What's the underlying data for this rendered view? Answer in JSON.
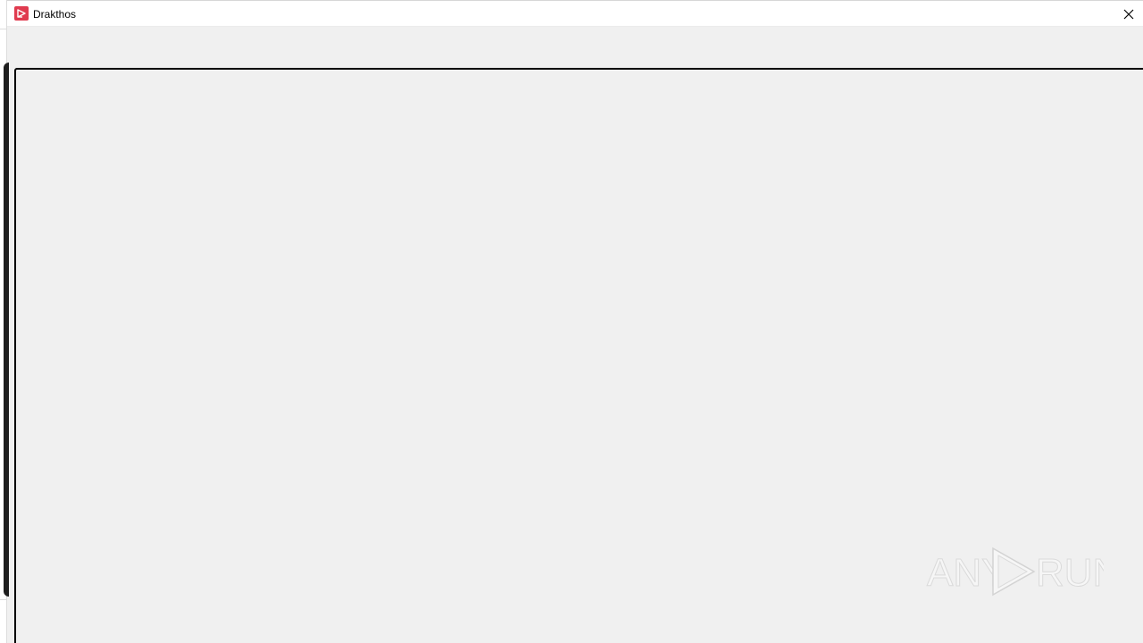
{
  "window": {
    "title": "Drakthos",
    "icon": "app-logo-icon",
    "close_icon": "close-icon"
  },
  "watermark": {
    "text_left": "ANY",
    "text_right": "RUN",
    "icon": "play-triangle-icon"
  },
  "colors": {
    "app_icon": "#e03b4f",
    "background": "#f0f0f0",
    "panel_border": "#000000"
  }
}
